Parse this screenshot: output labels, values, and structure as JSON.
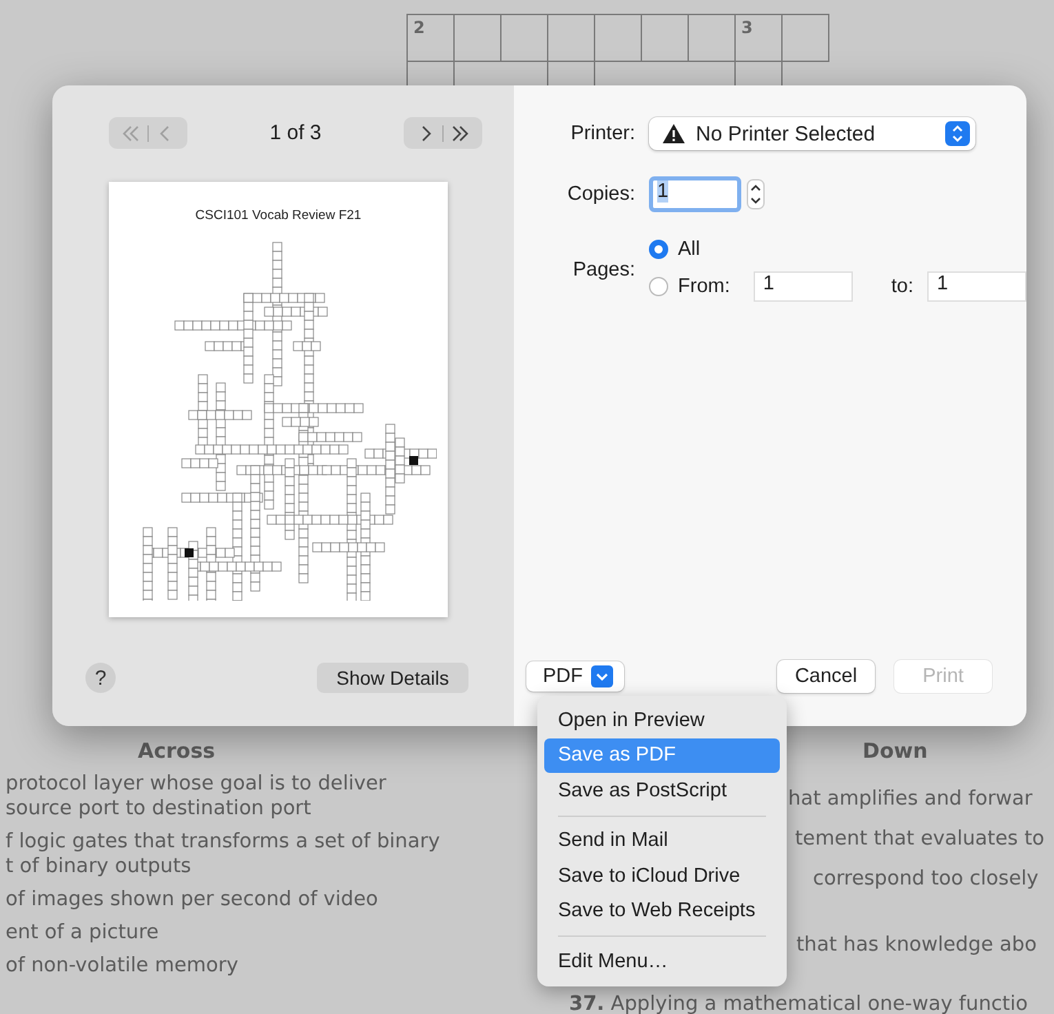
{
  "background_page": {
    "crossword": {
      "numbers": [
        "2",
        "3"
      ]
    },
    "across": {
      "heading": "Across",
      "clues": [
        {
          "lines": [
            "protocol layer whose goal is to deliver",
            "source port to destination port"
          ]
        },
        {
          "lines": [
            "f logic gates that transforms a set of binary",
            "t of binary outputs"
          ]
        },
        {
          "lines": [
            "of images shown per second of video"
          ]
        },
        {
          "lines": [
            "ent of a picture"
          ]
        },
        {
          "lines": [
            "of non-volatile memory"
          ]
        }
      ]
    },
    "down": {
      "heading": "Down",
      "clues": [
        {
          "lines": [
            "hat amplifies and forwar"
          ]
        },
        {
          "lines": [
            "tement that evaluates to"
          ]
        },
        {
          "lines": [
            "correspond too closely"
          ]
        },
        {
          "lines": [
            "that has knowledge abo"
          ]
        },
        {
          "lines": [
            "**37.** Applying a mathematical one-way functio"
          ]
        }
      ]
    }
  },
  "print_dialog": {
    "preview": {
      "nav_buttons": [
        {
          "kind": "first",
          "disabled": true
        },
        {
          "kind": "prev",
          "disabled": true
        },
        {
          "kind": "next",
          "disabled": false
        },
        {
          "kind": "last",
          "disabled": false
        }
      ],
      "page_indicator": "1 of 3",
      "page_title": "CSCI101 Vocab Review F21"
    },
    "help_button": "?",
    "show_details_button": "Show Details",
    "printer": {
      "label": "Printer:",
      "value": "No Printer Selected"
    },
    "copies": {
      "label": "Copies:",
      "value": "1"
    },
    "pages": {
      "label": "Pages:",
      "options": [
        {
          "label": "All",
          "selected": true
        },
        {
          "label": "From:",
          "selected": false
        }
      ],
      "from": "1",
      "to_label": "to:",
      "to": "1"
    },
    "pdf_button": "PDF",
    "cancel_button": "Cancel",
    "print_button": {
      "label": "Print",
      "disabled": true
    }
  },
  "pdf_menu": {
    "items": [
      {
        "kind": "item",
        "label": "Open in Preview",
        "selected": false
      },
      {
        "kind": "item",
        "label": "Save as PDF",
        "selected": true
      },
      {
        "kind": "item",
        "label": "Save as PostScript",
        "selected": false
      },
      {
        "kind": "separator"
      },
      {
        "kind": "item",
        "label": "Send in Mail",
        "selected": false
      },
      {
        "kind": "item",
        "label": "Save to iCloud Drive",
        "selected": false
      },
      {
        "kind": "item",
        "label": "Save to Web Receipts",
        "selected": false
      },
      {
        "kind": "separator"
      },
      {
        "kind": "item",
        "label": "Edit Menu…",
        "selected": false
      }
    ]
  }
}
